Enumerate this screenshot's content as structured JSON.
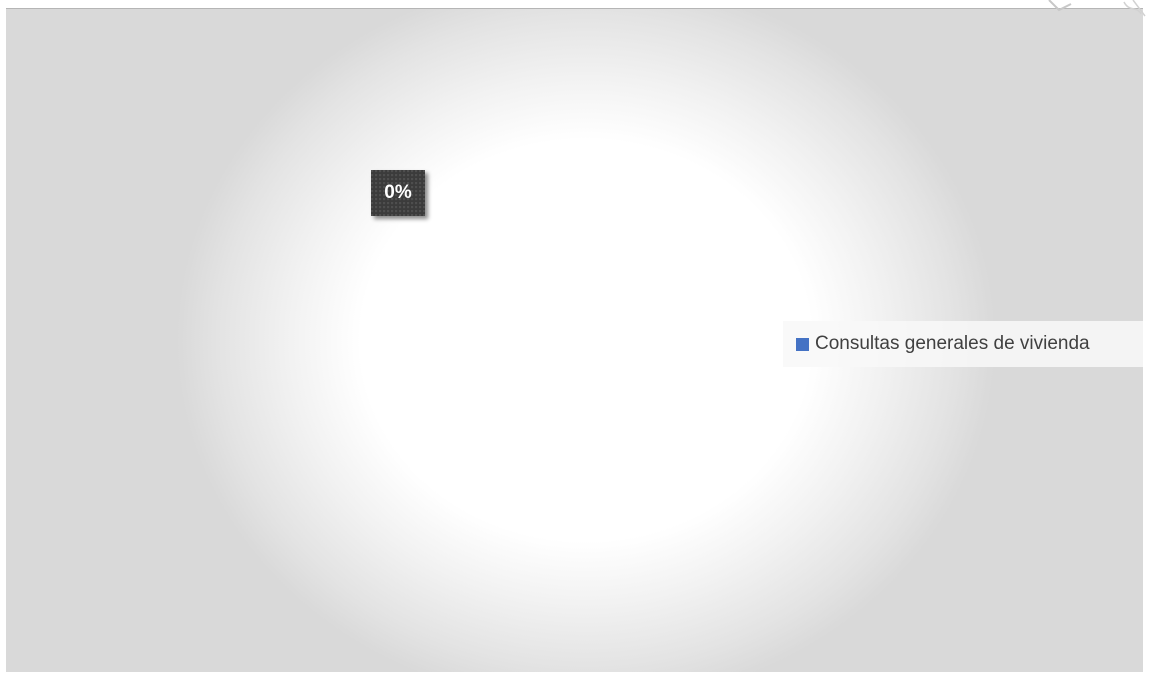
{
  "chart_data": {
    "type": "pie",
    "title": "",
    "categories": [
      "Consultas generales de vivienda"
    ],
    "values": [
      0
    ],
    "data_labels": [
      "0%"
    ],
    "legend_placement": "right",
    "colors": {
      "series": "#4472c4",
      "label_bg": "#3b3b3b",
      "label_text": "#ffffff"
    }
  }
}
